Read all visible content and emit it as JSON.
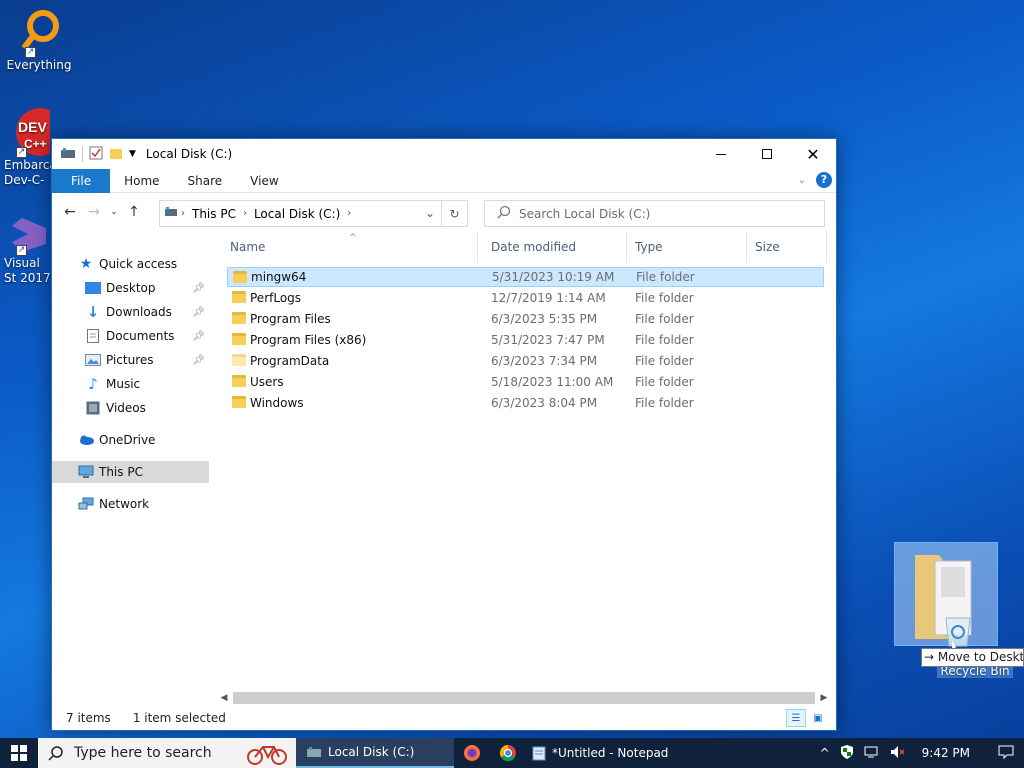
{
  "desktop": {
    "icons": [
      {
        "label": "Everything"
      },
      {
        "label": "Embarca Dev-C-"
      },
      {
        "label": "Visual St 2017"
      }
    ]
  },
  "window": {
    "title": "Local Disk (C:)",
    "tabs": [
      "File",
      "Home",
      "Share",
      "View"
    ],
    "address": {
      "crumbs": [
        "This PC",
        "Local Disk (C:)"
      ]
    },
    "search_placeholder": "Search Local Disk (C:)",
    "nav": {
      "quick_access": "Quick access",
      "pinned": [
        "Desktop",
        "Downloads",
        "Documents",
        "Pictures"
      ],
      "unpinned": [
        "Music",
        "Videos"
      ],
      "onedrive": "OneDrive",
      "this_pc": "This PC",
      "network": "Network"
    },
    "columns": [
      "Name",
      "Date modified",
      "Type",
      "Size"
    ],
    "rows": [
      {
        "name": "mingw64",
        "date": "5/31/2023 10:19 AM",
        "type": "File folder",
        "selected": true
      },
      {
        "name": "PerfLogs",
        "date": "12/7/2019 1:14 AM",
        "type": "File folder"
      },
      {
        "name": "Program Files",
        "date": "6/3/2023 5:35 PM",
        "type": "File folder"
      },
      {
        "name": "Program Files (x86)",
        "date": "5/31/2023 7:47 PM",
        "type": "File folder"
      },
      {
        "name": "ProgramData",
        "date": "6/3/2023 7:34 PM",
        "type": "File folder",
        "light": true
      },
      {
        "name": "Users",
        "date": "5/18/2023 11:00 AM",
        "type": "File folder"
      },
      {
        "name": "Windows",
        "date": "6/3/2023 8:04 PM",
        "type": "File folder"
      }
    ],
    "status": {
      "count": "7 items",
      "selection": "1 item selected"
    }
  },
  "drag": {
    "tooltip": "→ Move to Desktop",
    "target_label": "Recycle Bin"
  },
  "taskbar": {
    "search_placeholder": "Type here to search",
    "apps": [
      "Local Disk (C:)",
      "*Untitled - Notepad"
    ],
    "time": "9:42 PM"
  }
}
